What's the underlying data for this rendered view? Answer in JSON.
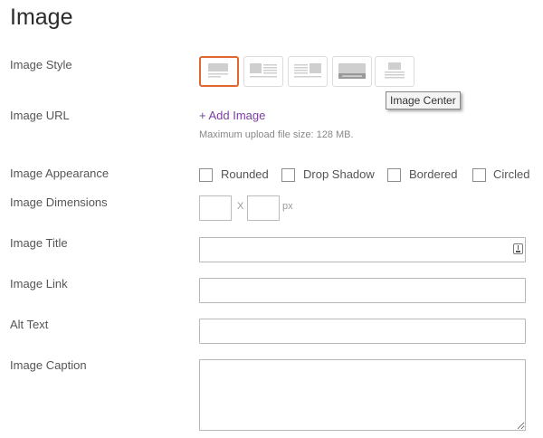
{
  "page": {
    "title": "Image"
  },
  "image_style": {
    "label": "Image Style",
    "options": [
      {
        "name": "image-left-icon",
        "selected": true
      },
      {
        "name": "image-left-text-icon",
        "selected": false
      },
      {
        "name": "image-right-text-icon",
        "selected": false
      },
      {
        "name": "image-wide-icon",
        "selected": false
      },
      {
        "name": "image-center-icon",
        "selected": false
      }
    ],
    "tooltip": "Image Center"
  },
  "image_url": {
    "label": "Image URL",
    "add_label": "+ Add Image",
    "hint": "Maximum upload file size: 128 MB."
  },
  "appearance": {
    "label": "Image Appearance",
    "options": [
      {
        "label": "Rounded",
        "checked": false
      },
      {
        "label": "Drop Shadow",
        "checked": false
      },
      {
        "label": "Bordered",
        "checked": false
      },
      {
        "label": "Circled",
        "checked": false
      }
    ]
  },
  "dimensions": {
    "label": "Image Dimensions",
    "separator": "X",
    "unit": "px",
    "width": "",
    "height": ""
  },
  "title_field": {
    "label": "Image Title",
    "value": ""
  },
  "link_field": {
    "label": "Image Link",
    "value": ""
  },
  "alt_field": {
    "label": "Alt Text",
    "value": ""
  },
  "caption_field": {
    "label": "Image Caption",
    "value": ""
  },
  "colors": {
    "accent": "#e0672f",
    "link": "#7b3fa0"
  }
}
